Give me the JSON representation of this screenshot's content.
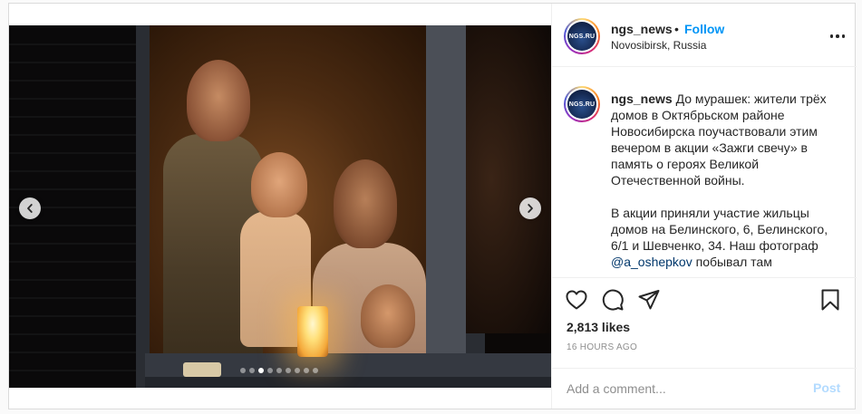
{
  "post": {
    "username": "ngs_news",
    "separator": "•",
    "follow_label": "Follow",
    "location": "Novosibirsk, Russia",
    "avatar_text": "NGS.RU",
    "caption_paragraph_1": "До мурашек: жители трёх домов в Октябрьском районе Новосибирска поучаствовали этим вечером в акции «Зажги свечу» в память о героях Великой Отечественной войны.",
    "caption_paragraph_2_prefix": "В акции приняли участие жильцы домов на Белинского, 6, Белинского, 6/1 и Шевченко, 34. Наш фотограф ",
    "caption_mention": "@a_oshepkov",
    "caption_paragraph_2_suffix": " побывал там",
    "likes": "2,813 likes",
    "timestamp": "16 HOURS AGO",
    "comment_placeholder": "Add a comment...",
    "post_label": "Post"
  },
  "carousel": {
    "total_slides": 9,
    "active_slide": 3
  },
  "icons": {
    "more": "more-options-icon",
    "like": "heart-icon",
    "comment": "comment-icon",
    "share": "paper-plane-icon",
    "save": "bookmark-icon",
    "prev": "chevron-left-icon",
    "next": "chevron-right-icon"
  },
  "colors": {
    "accent": "#0095f6",
    "text": "#262626",
    "muted": "#8e8e8e",
    "post_disabled": "#b3dbff",
    "mention": "#00376b"
  }
}
